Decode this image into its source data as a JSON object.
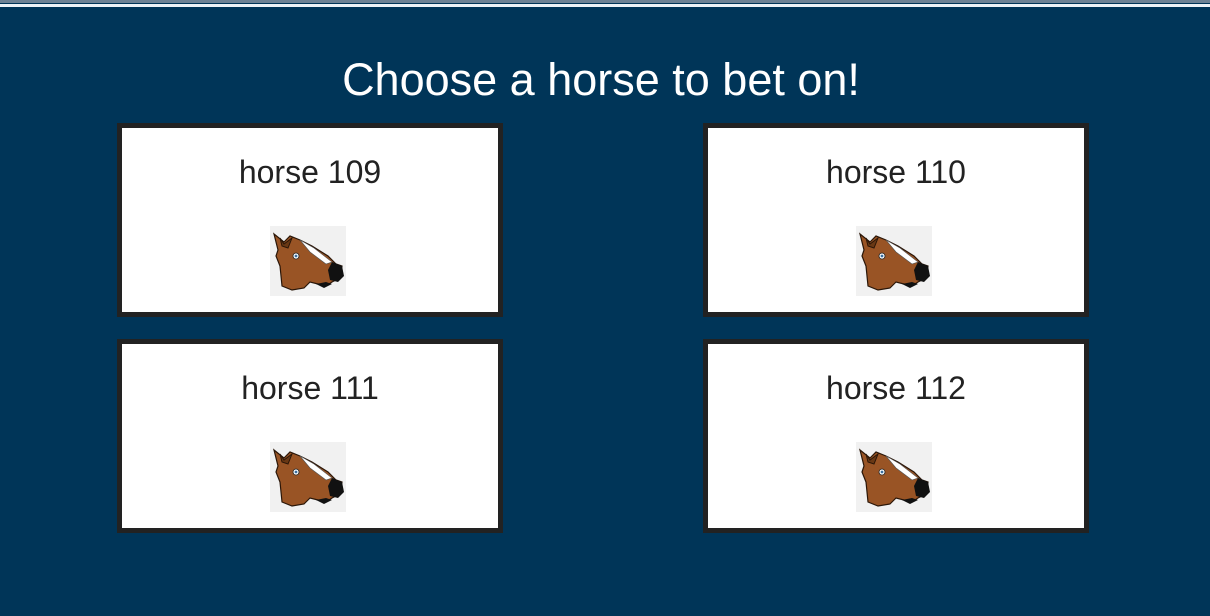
{
  "page": {
    "heading": "Choose a horse to bet on!"
  },
  "horses": [
    {
      "name": "horse 109",
      "icon": "horse-head-icon"
    },
    {
      "name": "horse 110",
      "icon": "horse-head-icon"
    },
    {
      "name": "horse 111",
      "icon": "horse-head-icon"
    },
    {
      "name": "horse 112",
      "icon": "horse-head-icon"
    }
  ],
  "colors": {
    "background": "#003558",
    "card_background": "#ffffff",
    "card_border": "#222222",
    "heading_text": "#ffffff",
    "card_text": "#222222"
  }
}
